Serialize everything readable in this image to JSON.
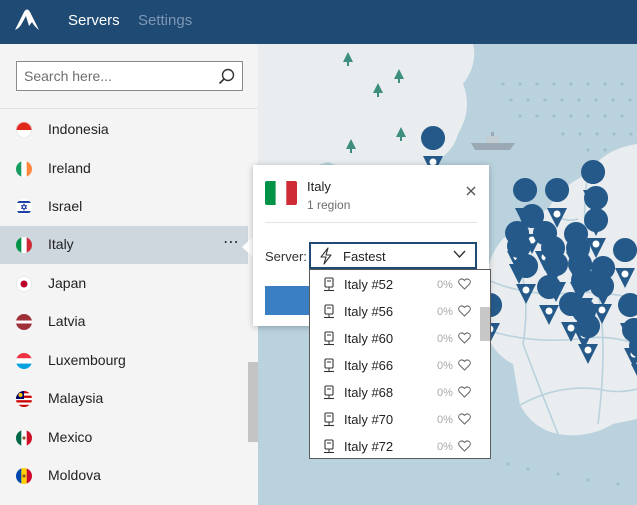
{
  "nav": {
    "logo_icon": "nordvpn-mountain-logo",
    "tabs": [
      {
        "label": "Servers",
        "active": true
      },
      {
        "label": "Settings",
        "active": false
      }
    ]
  },
  "search": {
    "placeholder": "Search here...",
    "value": "",
    "icon": "search-icon"
  },
  "countries": [
    {
      "label": "Indonesia"
    },
    {
      "label": "Ireland"
    },
    {
      "label": "Israel"
    },
    {
      "label": "Italy",
      "selected": true,
      "more": "⋯"
    },
    {
      "label": "Japan"
    },
    {
      "label": "Latvia"
    },
    {
      "label": "Luxembourg"
    },
    {
      "label": "Malaysia"
    },
    {
      "label": "Mexico"
    },
    {
      "label": "Moldova"
    }
  ],
  "popup": {
    "title": "Italy",
    "subtitle": "1 region",
    "server_label": "Server:",
    "selected_server": "Fastest",
    "servers": [
      {
        "name": "Italy #52",
        "load": "0%"
      },
      {
        "name": "Italy #56",
        "load": "0%"
      },
      {
        "name": "Italy #60",
        "load": "0%"
      },
      {
        "name": "Italy #66",
        "load": "0%"
      },
      {
        "name": "Italy #68",
        "load": "0%"
      },
      {
        "name": "Italy #70",
        "load": "0%"
      },
      {
        "name": "Italy #72",
        "load": "0%"
      }
    ]
  },
  "colors": {
    "topbar": "#1e4a73",
    "map_sea": "#b9d2dd",
    "map_land": "#e9edef",
    "pin": "#25598a",
    "connect_button": "#3a7ec4",
    "selected_row": "#cfd7de"
  }
}
